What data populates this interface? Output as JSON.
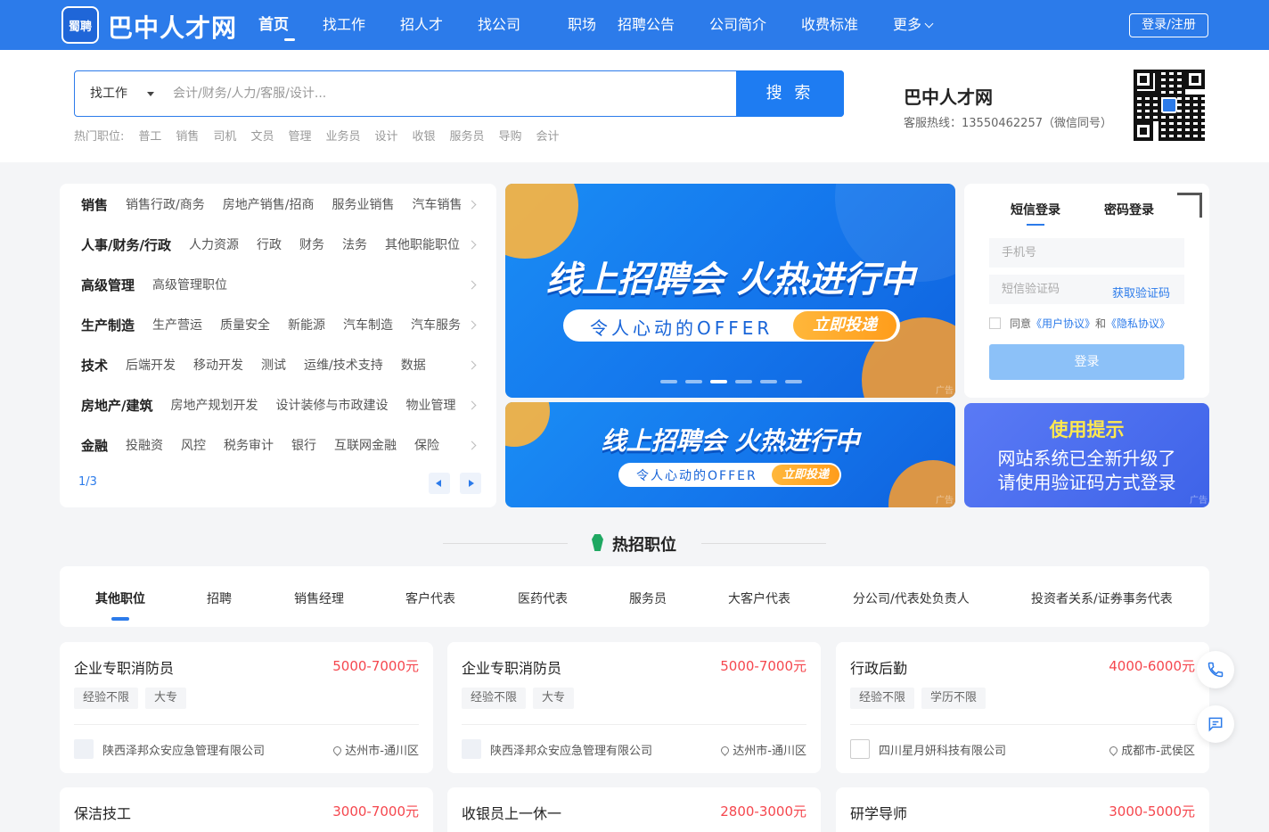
{
  "header": {
    "logo_mark": "蜀聘",
    "site_title": "巴中人才网",
    "nav": [
      "首页",
      "找工作",
      "招人才",
      "找公司",
      "职场",
      "招聘公告",
      "公司简介",
      "收费标准",
      "更多"
    ],
    "login_register": "登录/注册"
  },
  "search": {
    "type_select": "找工作",
    "placeholder": "会计/财务/人力/客服/设计...",
    "button": "搜 索",
    "hot_label": "热门职位:",
    "hot_jobs": [
      "普工",
      "销售",
      "司机",
      "文员",
      "管理",
      "业务员",
      "设计",
      "收银",
      "服务员",
      "导购",
      "会计"
    ]
  },
  "contact": {
    "site_name": "巴中人才网",
    "hotline": "客服热线：13550462257（微信同号）"
  },
  "categories": {
    "rows": [
      {
        "title": "销售",
        "subs": [
          "销售行政/商务",
          "房地产销售/招商",
          "服务业销售",
          "汽车销售"
        ]
      },
      {
        "title": "人事/财务/行政",
        "subs": [
          "人力资源",
          "行政",
          "财务",
          "法务",
          "其他职能职位"
        ]
      },
      {
        "title": "高级管理",
        "subs": [
          "高级管理职位"
        ]
      },
      {
        "title": "生产制造",
        "subs": [
          "生产营运",
          "质量安全",
          "新能源",
          "汽车制造",
          "汽车服务"
        ]
      },
      {
        "title": "技术",
        "subs": [
          "后端开发",
          "移动开发",
          "测试",
          "运维/技术支持",
          "数据"
        ]
      },
      {
        "title": "房地产/建筑",
        "subs": [
          "房地产规划开发",
          "设计装修与市政建设",
          "物业管理"
        ]
      },
      {
        "title": "金融",
        "subs": [
          "投融资",
          "风控",
          "税务审计",
          "银行",
          "互联网金融",
          "保险"
        ]
      }
    ],
    "page": "1/3"
  },
  "banners": [
    {
      "title": "线上招聘会 火热进行中",
      "subtitle": "令人心动的OFFER",
      "cta": "立即投递",
      "ad": "广告"
    },
    {
      "title": "线上招聘会 火热进行中",
      "subtitle": "令人心动的OFFER",
      "cta": "立即投递",
      "ad": "广告"
    }
  ],
  "login": {
    "tab_sms": "短信登录",
    "tab_password": "密码登录",
    "phone_placeholder": "手机号",
    "code_placeholder": "短信验证码",
    "get_code": "获取验证码",
    "agree_prefix": "同意",
    "user_agreement": "《用户协议》",
    "and": "和",
    "privacy": "《隐私协议》",
    "submit": "登录"
  },
  "tip": {
    "title": "使用提示",
    "line1": "网站系统已全新升级了",
    "line2": "请使用验证码方式登录",
    "ad": "广告"
  },
  "hot_section": {
    "title": "热招职位",
    "tabs": [
      "其他职位",
      "招聘",
      "销售经理",
      "客户代表",
      "医药代表",
      "服务员",
      "大客户代表",
      "分公司/代表处负责人",
      "投资者关系/证券事务代表"
    ]
  },
  "jobs": [
    {
      "title": "企业专职消防员",
      "salary": "5000-7000元",
      "tags": [
        "经验不限",
        "大专"
      ],
      "company": "陕西泽邦众安应急管理有限公司",
      "location": "达州市-通川区"
    },
    {
      "title": "企业专职消防员",
      "salary": "5000-7000元",
      "tags": [
        "经验不限",
        "大专"
      ],
      "company": "陕西泽邦众安应急管理有限公司",
      "location": "达州市-通川区"
    },
    {
      "title": "行政后勤",
      "salary": "4000-6000元",
      "tags": [
        "经验不限",
        "学历不限"
      ],
      "company": "四川星月妍科技有限公司",
      "location": "成都市-武侯区"
    },
    {
      "title": "保洁技工",
      "salary": "3000-7000元"
    },
    {
      "title": "收银员上一休一",
      "salary": "2800-3000元"
    },
    {
      "title": "研学导师",
      "salary": "3000-5000元"
    }
  ],
  "colors": {
    "primary": "#2c7bea",
    "salary": "#f5474e",
    "tip_title": "#ffe84f"
  }
}
